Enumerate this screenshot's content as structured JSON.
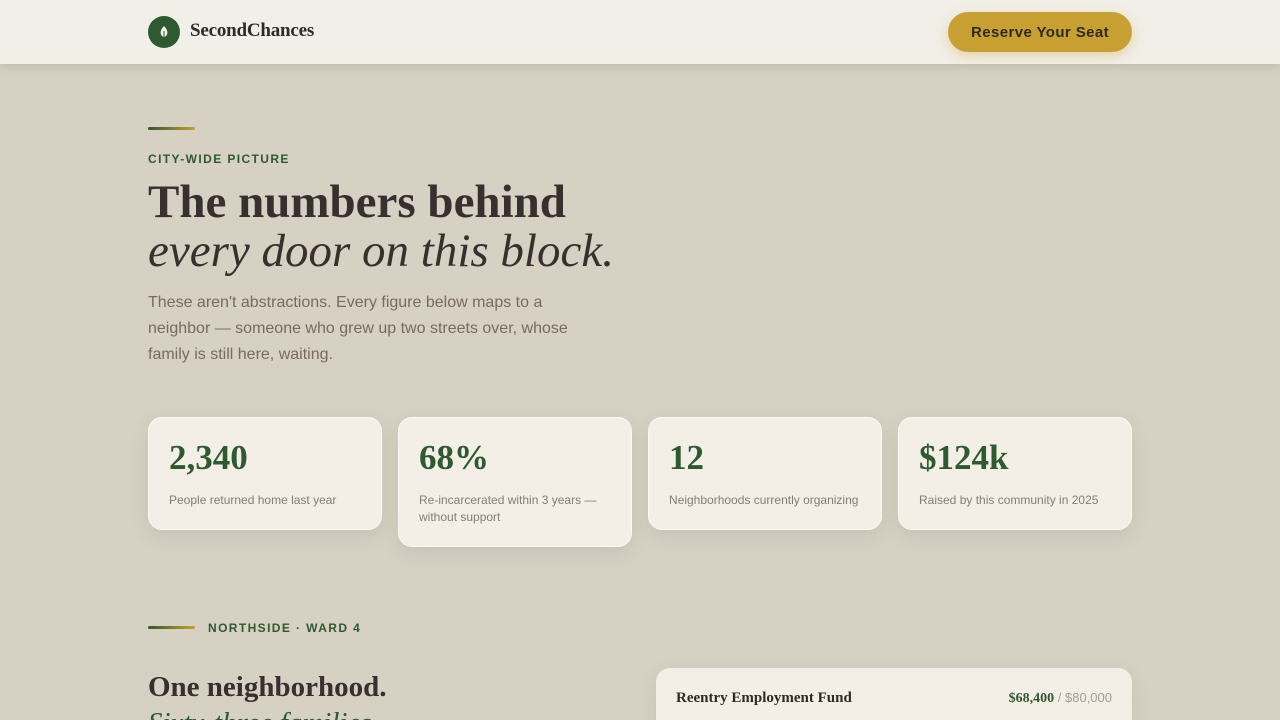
{
  "header": {
    "brand": "SecondChances",
    "logo_icon": "leaf-icon",
    "cta_label": "Reserve Your Seat"
  },
  "hero": {
    "eyebrow": "CITY-WIDE PICTURE",
    "title_line1": "The numbers behind",
    "title_line2": "every door on this block.",
    "lede": "These aren't abstractions. Every figure below maps to a neighbor — someone who grew up two streets over, whose family is still here, waiting."
  },
  "stats": [
    {
      "value": "2,340",
      "label": "People returned home last year"
    },
    {
      "value": "68%",
      "label": "Re-incarcerated within 3 years — without support"
    },
    {
      "value": "12",
      "label": "Neighborhoods currently organizing"
    },
    {
      "value": "$124k",
      "label": "Raised by this community in 2025"
    }
  ],
  "section2": {
    "eyebrow": "NORTHSIDE · WARD 4",
    "title_line1": "One neighborhood.",
    "title_line2": "Sixty-three families."
  },
  "fund": {
    "name": "Reentry Employment Fund",
    "raised": "$68,400",
    "separator": "/",
    "goal": "$80,000"
  },
  "colors": {
    "background": "#d6d1c3",
    "header": "#f2efe8",
    "accent_green": "#2d5a2e",
    "accent_gold": "#c8a032",
    "card": "#f3efe7"
  }
}
